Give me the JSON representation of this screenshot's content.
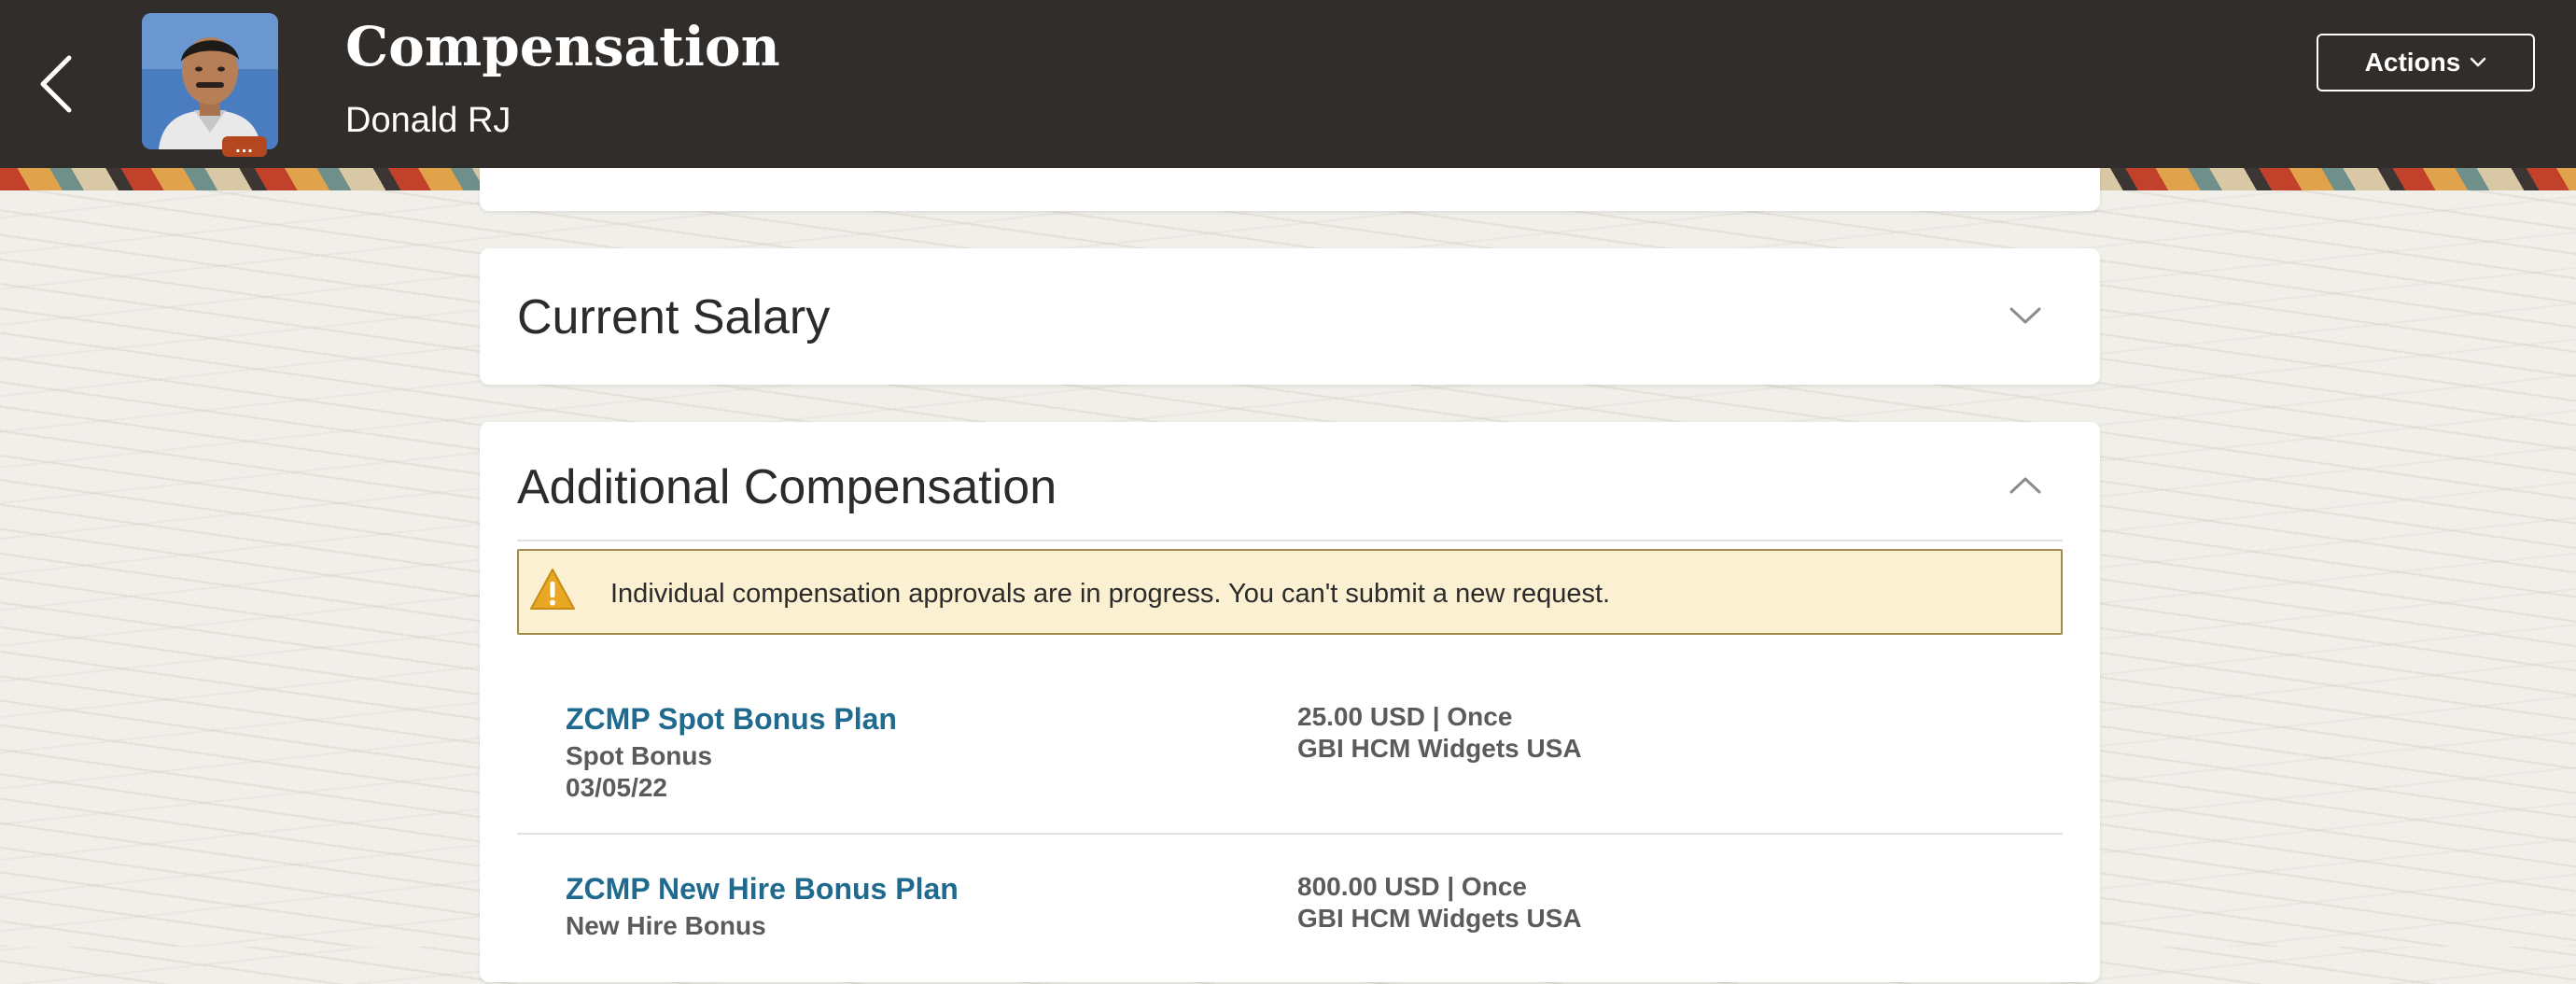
{
  "header": {
    "title": "Compensation",
    "person_name": "Donald RJ",
    "actions_label": "Actions",
    "avatar_more_label": "..."
  },
  "sections": {
    "current_salary": {
      "title": "Current Salary",
      "expanded": false
    },
    "additional_compensation": {
      "title": "Additional Compensation",
      "expanded": true,
      "alert": {
        "type": "warning",
        "icon": "warning-icon",
        "text": "Individual compensation approvals are in progress. You can't submit a new request."
      },
      "plans": [
        {
          "name": "ZCMP Spot Bonus Plan",
          "type": "Spot Bonus",
          "date": "03/05/22",
          "amount": "25.00 USD | Once",
          "org": "GBI HCM Widgets USA"
        },
        {
          "name": "ZCMP New Hire Bonus Plan",
          "type": "New Hire Bonus",
          "date": "",
          "amount": "800.00 USD | Once",
          "org": "GBI HCM Widgets USA"
        }
      ]
    }
  },
  "colors": {
    "header_bg": "#312d2a",
    "link": "#1f6a8e",
    "alert_bg": "#fbf0d1",
    "alert_icon": "#e8a824"
  }
}
